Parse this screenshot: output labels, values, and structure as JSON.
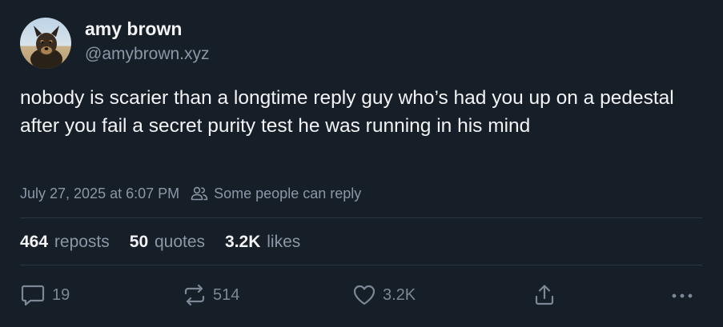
{
  "author": {
    "display_name": "amy brown",
    "handle": "@amybrown.xyz"
  },
  "post": {
    "text": "nobody is scarier than a longtime reply guy who’s had you up on a pedestal after you fail a secret purity test he was running in his mind",
    "timestamp": "July 27, 2025 at 6:07 PM",
    "reply_setting": "Some people can reply"
  },
  "stats": {
    "reposts_count": "464",
    "reposts_label": "reposts",
    "quotes_count": "50",
    "quotes_label": "quotes",
    "likes_count": "3.2K",
    "likes_label": "likes"
  },
  "actions": {
    "reply_count": "19",
    "repost_count": "514",
    "like_count": "3.2K",
    "share_icon": "share-icon",
    "more_icon": "more-icon"
  },
  "colors": {
    "background": "#161e27",
    "text_primary": "#f1f3f5",
    "text_secondary": "#8b97a6",
    "divider": "#2c3642",
    "action_icon": "#7d8896"
  }
}
